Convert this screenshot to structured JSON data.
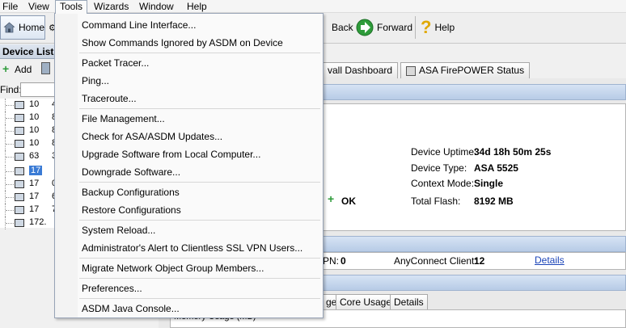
{
  "menubar": {
    "items": [
      "File",
      "View",
      "Tools",
      "Wizards",
      "Window",
      "Help"
    ]
  },
  "toolbar": {
    "home": "Home",
    "back": "Back",
    "forward": "Forward",
    "help": "Help"
  },
  "device_panel": {
    "title": "Device List",
    "add": "Add",
    "find_label": "Find:",
    "find_value": "",
    "rows": [
      "10",
      "10",
      "10",
      "10",
      "63",
      "17",
      "17",
      "17",
      "17",
      "172."
    ],
    "row_suffix": [
      "4",
      "8",
      "8",
      "8",
      "3",
      "",
      "0",
      "6",
      "7",
      "3"
    ]
  },
  "tools_menu": {
    "items": [
      "Command Line Interface...",
      "Show Commands Ignored by ASDM on Device",
      "Packet Tracer...",
      "Ping...",
      "Traceroute...",
      "File Management...",
      "Check for ASA/ASDM Updates...",
      "Upgrade Software from Local Computer...",
      "Downgrade Software...",
      "Backup Configurations",
      "Restore Configurations",
      "System Reload...",
      "Administrator's Alert to Clientless SSL VPN Users...",
      "Migrate Network Object Group Members...",
      "Preferences...",
      "ASDM Java Console..."
    ]
  },
  "tabs": [
    "vall Dashboard",
    "ASA FirePOWER Status"
  ],
  "device_info": {
    "uptime_label": "Device Uptime:",
    "uptime_value": "34d 18h 50m 25s",
    "type_label": "Device Type:",
    "type_value": "ASA 5525",
    "mode_label": "Context Mode:",
    "mode_value": "Single",
    "flash_label": "Total Flash:",
    "flash_value": "8192 MB",
    "status_value": "OK"
  },
  "vpn": {
    "ipsec_label": "PN:",
    "ipsec_value": "0",
    "anyconnect_label": "AnyConnect Client:",
    "anyconnect_value": "12",
    "details_link": "Details"
  },
  "subtabs": [
    "ge",
    "Core Usage",
    "Details"
  ],
  "memory_label": "Memory Usage (MB)"
}
